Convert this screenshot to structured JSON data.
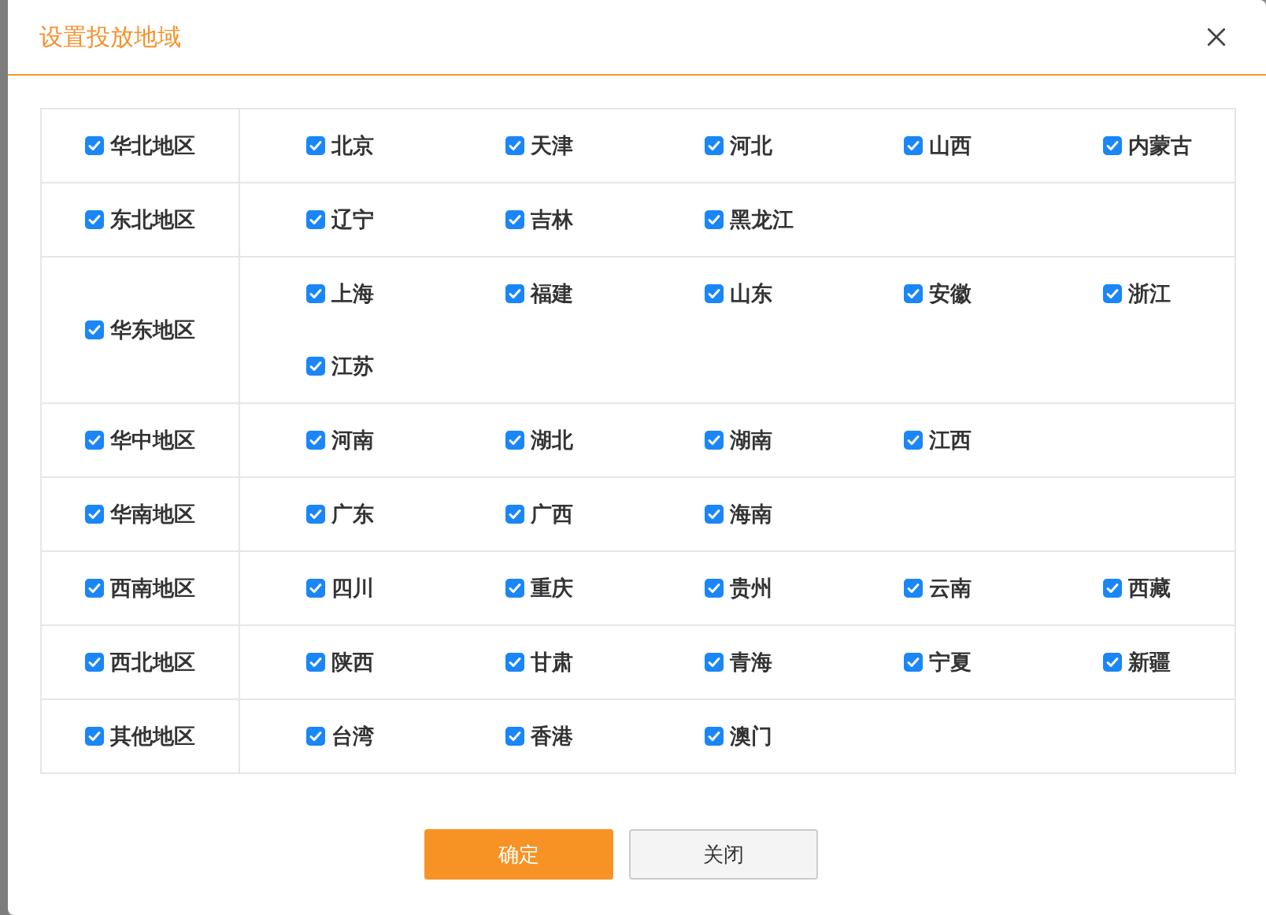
{
  "dialog": {
    "title": "设置投放地域"
  },
  "regions": [
    {
      "name": "华北地区",
      "checked": true,
      "provinces": [
        {
          "name": "北京",
          "checked": true
        },
        {
          "name": "天津",
          "checked": true
        },
        {
          "name": "河北",
          "checked": true
        },
        {
          "name": "山西",
          "checked": true
        },
        {
          "name": "内蒙古",
          "checked": true
        }
      ]
    },
    {
      "name": "东北地区",
      "checked": true,
      "provinces": [
        {
          "name": "辽宁",
          "checked": true
        },
        {
          "name": "吉林",
          "checked": true
        },
        {
          "name": "黑龙江",
          "checked": true
        }
      ]
    },
    {
      "name": "华东地区",
      "checked": true,
      "provinces": [
        {
          "name": "上海",
          "checked": true
        },
        {
          "name": "福建",
          "checked": true
        },
        {
          "name": "山东",
          "checked": true
        },
        {
          "name": "安徽",
          "checked": true
        },
        {
          "name": "浙江",
          "checked": true
        },
        {
          "name": "江苏",
          "checked": true
        }
      ]
    },
    {
      "name": "华中地区",
      "checked": true,
      "provinces": [
        {
          "name": "河南",
          "checked": true
        },
        {
          "name": "湖北",
          "checked": true
        },
        {
          "name": "湖南",
          "checked": true
        },
        {
          "name": "江西",
          "checked": true
        }
      ]
    },
    {
      "name": "华南地区",
      "checked": true,
      "provinces": [
        {
          "name": "广东",
          "checked": true
        },
        {
          "name": "广西",
          "checked": true
        },
        {
          "name": "海南",
          "checked": true
        }
      ]
    },
    {
      "name": "西南地区",
      "checked": true,
      "provinces": [
        {
          "name": "四川",
          "checked": true
        },
        {
          "name": "重庆",
          "checked": true
        },
        {
          "name": "贵州",
          "checked": true
        },
        {
          "name": "云南",
          "checked": true
        },
        {
          "name": "西藏",
          "checked": true
        }
      ]
    },
    {
      "name": "西北地区",
      "checked": true,
      "provinces": [
        {
          "name": "陕西",
          "checked": true
        },
        {
          "name": "甘肃",
          "checked": true
        },
        {
          "name": "青海",
          "checked": true
        },
        {
          "name": "宁夏",
          "checked": true
        },
        {
          "name": "新疆",
          "checked": true
        }
      ]
    },
    {
      "name": "其他地区",
      "checked": true,
      "provinces": [
        {
          "name": "台湾",
          "checked": true
        },
        {
          "name": "香港",
          "checked": true
        },
        {
          "name": "澳门",
          "checked": true
        }
      ]
    }
  ],
  "buttons": [
    {
      "label": "确定",
      "kind": "primary"
    },
    {
      "label": "关闭",
      "kind": "secondary"
    }
  ]
}
